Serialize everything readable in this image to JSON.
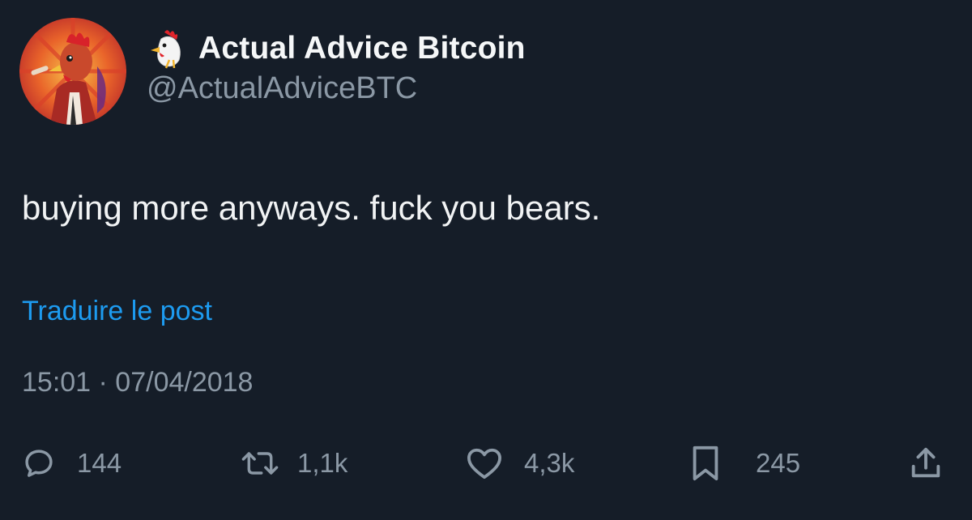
{
  "author": {
    "display_name": "Actual Advice Bitcoin",
    "handle": "@ActualAdviceBTC",
    "emoji_icon": "rooster-emoji-icon",
    "avatar_icon": "rooster-avatar"
  },
  "tweet": {
    "text": "buying more anyways. fuck you bears.",
    "translate_label": "Traduire le post",
    "timestamp": "15:01 · 07/04/2018"
  },
  "actions": {
    "replies": "144",
    "retweets": "1,1k",
    "likes": "4,3k",
    "bookmarks": "245"
  },
  "colors": {
    "background": "#151d28",
    "accent": "#1d9bf0",
    "muted": "#8b98a5",
    "text": "#e7e9ea"
  }
}
